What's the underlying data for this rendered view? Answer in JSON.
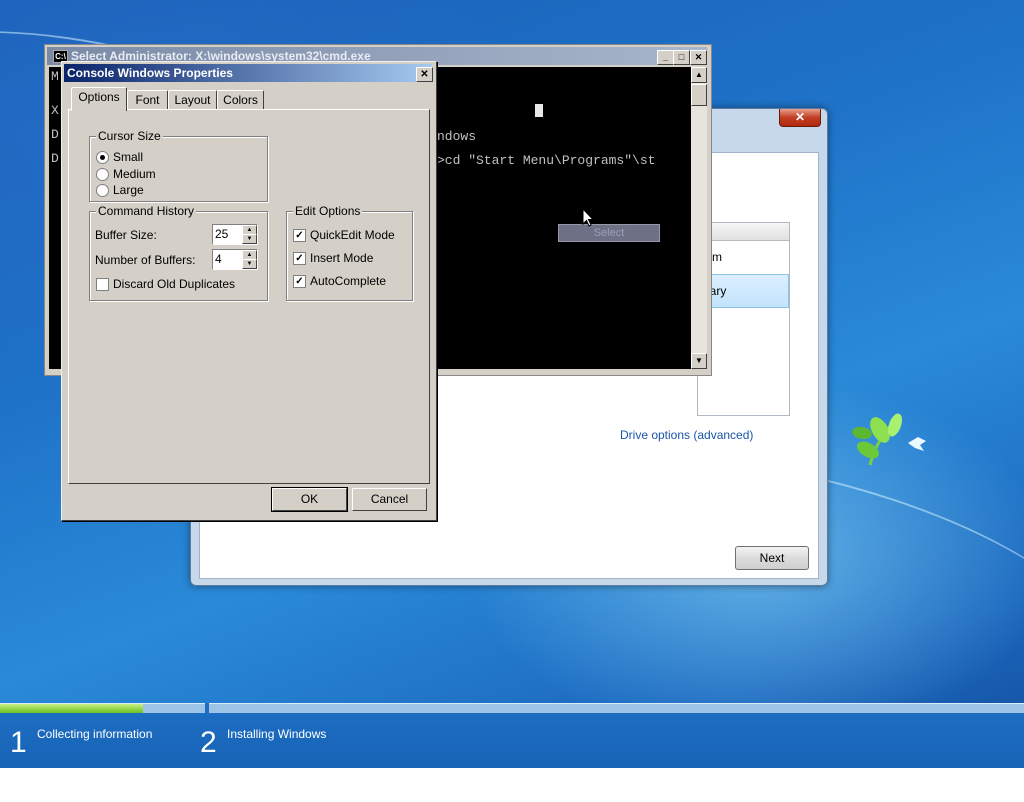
{
  "desktop": {
    "background_color": "#1e72c8"
  },
  "setup": {
    "close_glyph": "✕",
    "table_header_fragment": "e",
    "rows": [
      "tem",
      "nary"
    ],
    "drive_options_link": "Drive options (advanced)",
    "next_label": "Next"
  },
  "cmd": {
    "title": "Select Administrator: X:\\windows\\system32\\cmd.exe",
    "left_chars": [
      "M",
      "X",
      "D",
      "D"
    ],
    "line_windows": "ndows",
    "line_cd": ">cd \"Start Menu\\Programs\"\\st",
    "context_item": "Select",
    "min_glyph": "_",
    "max_glyph": "□",
    "close_glyph": "✕"
  },
  "props": {
    "title": "Console Windows Properties",
    "close_glyph": "✕",
    "tabs": [
      "Options",
      "Font",
      "Layout",
      "Colors"
    ],
    "cursor_size": {
      "title": "Cursor Size",
      "options": [
        "Small",
        "Medium",
        "Large"
      ],
      "selected": "Small"
    },
    "command_history": {
      "title": "Command History",
      "buffer_size_label": "Buffer Size:",
      "buffer_size_value": "25",
      "num_buffers_label": "Number of Buffers:",
      "num_buffers_value": "4",
      "discard_label": "Discard Old Duplicates",
      "discard_checked": false
    },
    "edit_options": {
      "title": "Edit Options",
      "quickedit_label": "QuickEdit Mode",
      "insert_label": "Insert Mode",
      "autocomplete_label": "AutoComplete",
      "check_glyph": "✓"
    },
    "ok_label": "OK",
    "cancel_label": "Cancel"
  },
  "progress": {
    "fraction": 0.14,
    "steps": [
      {
        "number": "1",
        "label": "Collecting information"
      },
      {
        "number": "2",
        "label": "Installing Windows"
      }
    ]
  }
}
